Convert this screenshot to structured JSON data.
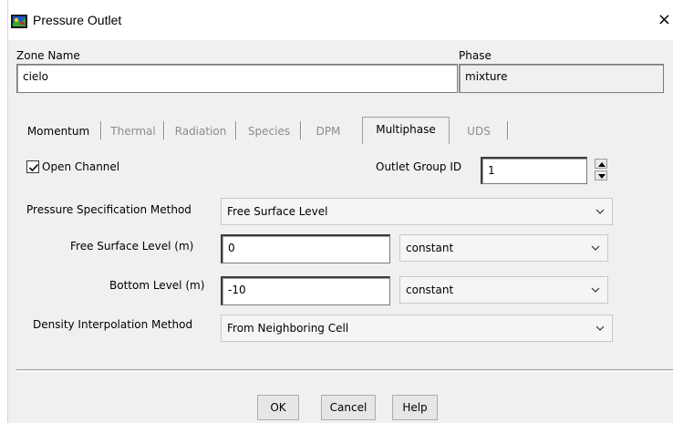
{
  "window": {
    "title": "Pressure Outlet",
    "close_glyph": "×"
  },
  "zone": {
    "label": "Zone Name",
    "value": "cielo"
  },
  "phase": {
    "label": "Phase",
    "value": "mixture"
  },
  "tabs": [
    {
      "label": "Momentum",
      "state": "enabled"
    },
    {
      "label": "Thermal",
      "state": "disabled"
    },
    {
      "label": "Radiation",
      "state": "disabled"
    },
    {
      "label": "Species",
      "state": "disabled"
    },
    {
      "label": "DPM",
      "state": "disabled"
    },
    {
      "label": "Multiphase",
      "state": "active"
    },
    {
      "label": "UDS",
      "state": "disabled"
    }
  ],
  "multiphase": {
    "open_channel": {
      "label": "Open Channel",
      "checked": true
    },
    "outlet_group": {
      "label": "Outlet Group ID",
      "value": "1"
    },
    "pressure_method": {
      "label": "Pressure Specification Method",
      "value": "Free Surface Level"
    },
    "free_surface": {
      "label": "Free Surface Level (m)",
      "value": "0",
      "mode": "constant"
    },
    "bottom_level": {
      "label": "Bottom Level (m)",
      "value": "-10",
      "mode": "constant"
    },
    "density_method": {
      "label": "Density Interpolation Method",
      "value": "From Neighboring Cell"
    }
  },
  "buttons": {
    "ok": "OK",
    "cancel": "Cancel",
    "help": "Help"
  },
  "icons": {
    "app": "fluent-app-icon",
    "close": "close-icon",
    "checkbox": "checkmark-icon",
    "spin_up": "spin-up-icon",
    "spin_down": "spin-down-icon",
    "dropdown": "chevron-down-icon"
  }
}
